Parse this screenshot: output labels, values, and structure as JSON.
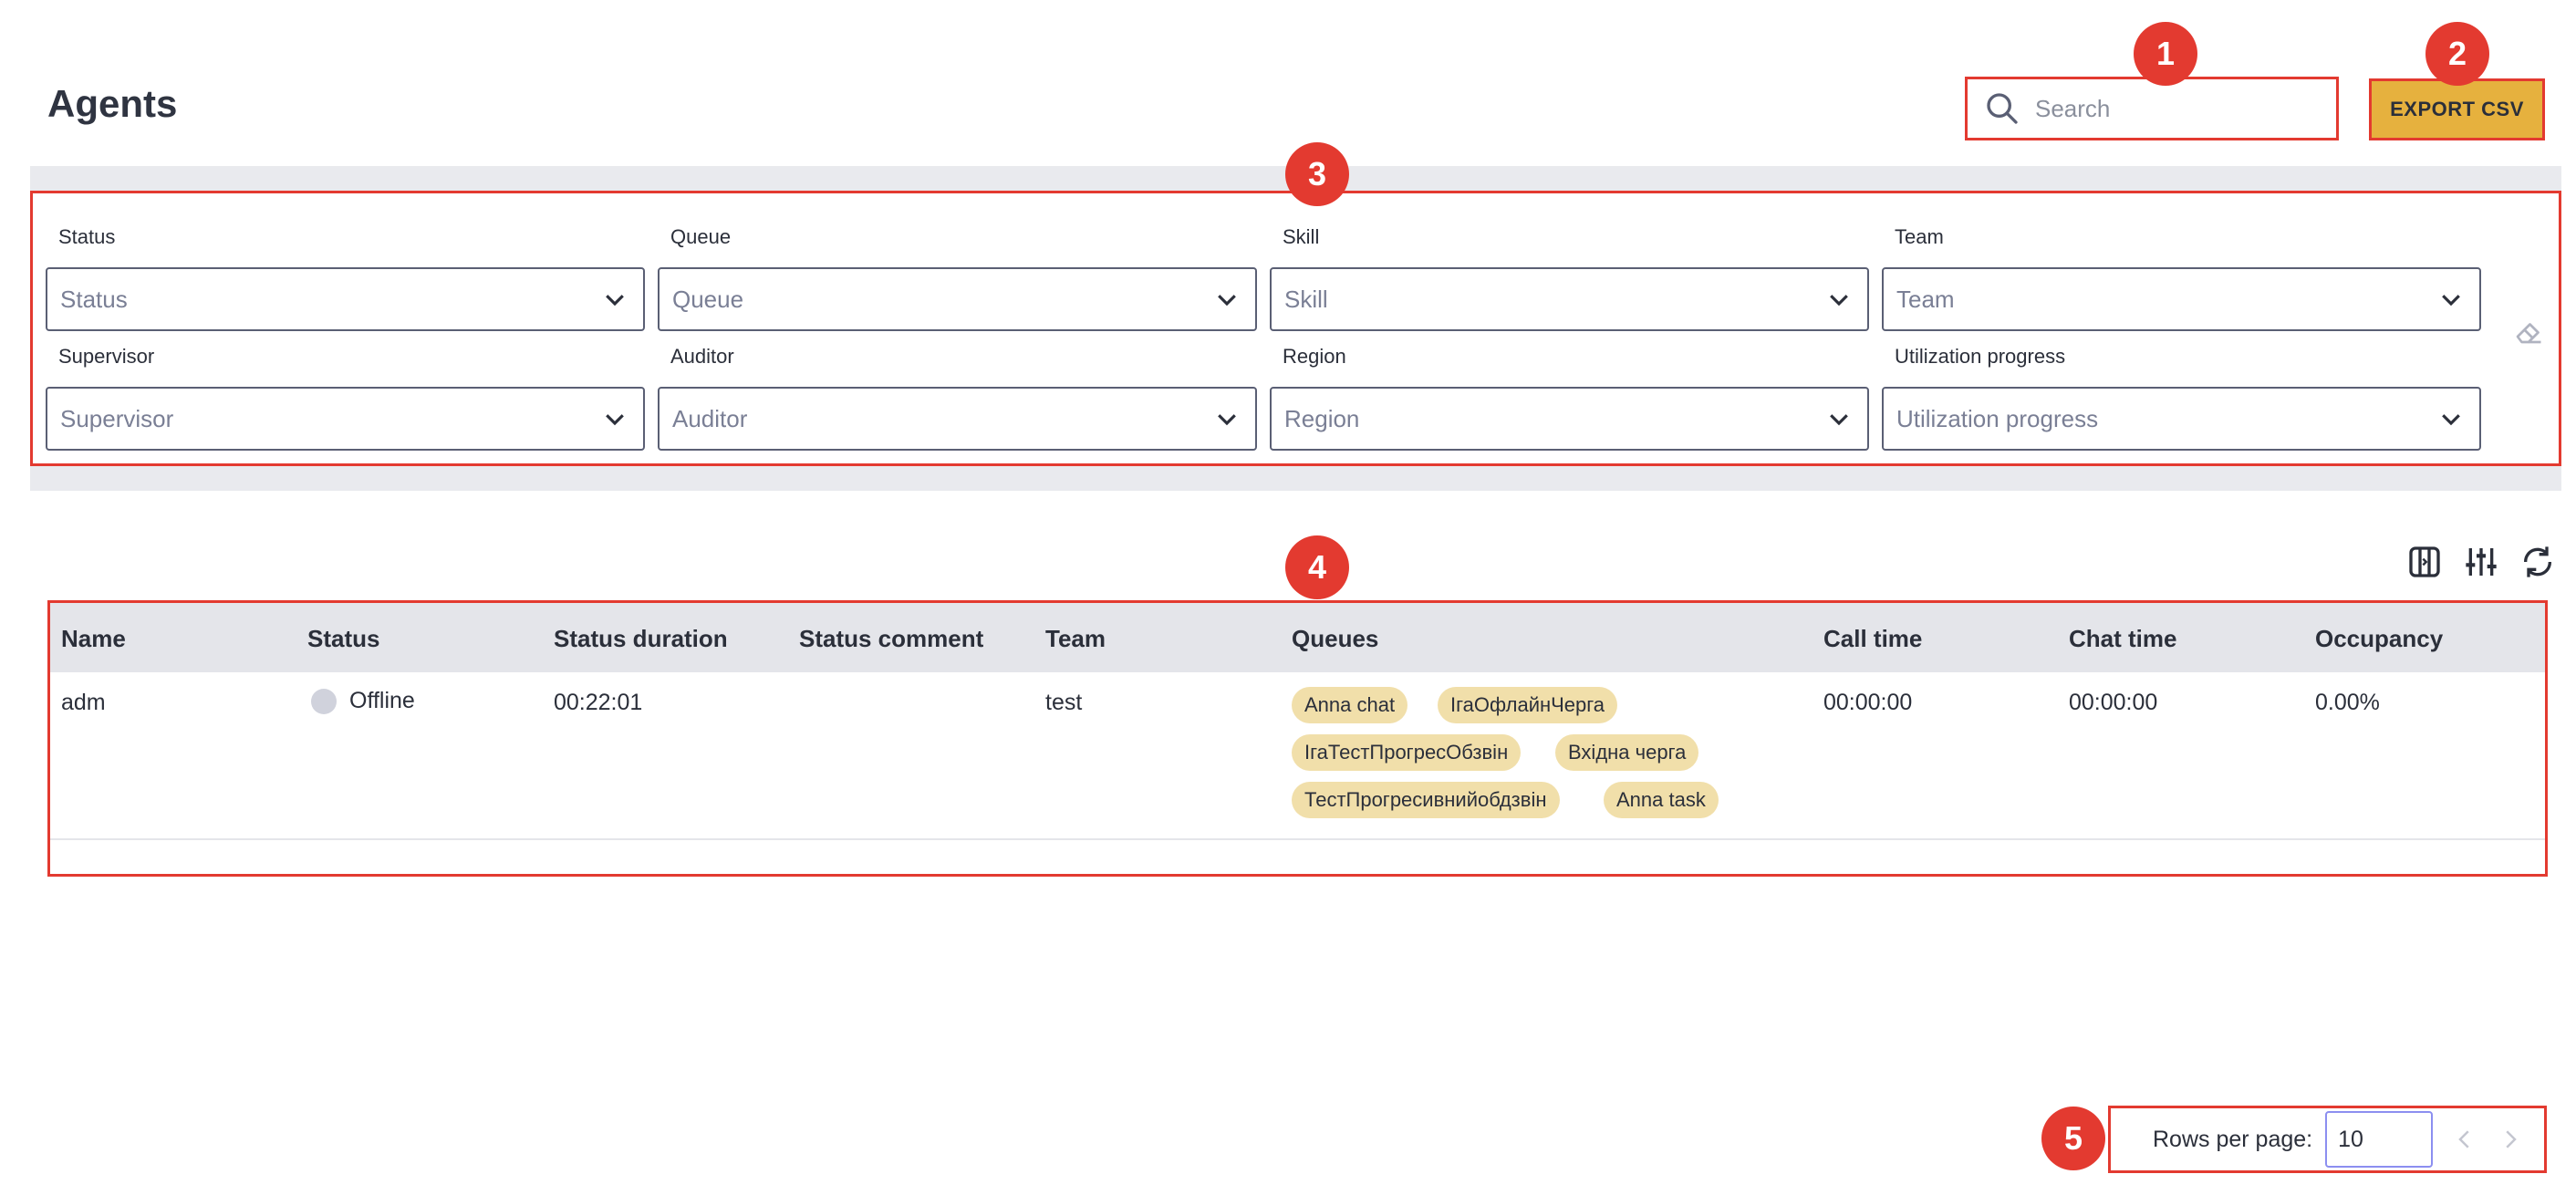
{
  "page": {
    "title": "Agents"
  },
  "search": {
    "placeholder": "Search"
  },
  "export": {
    "label": "EXPORT CSV"
  },
  "filters": [
    {
      "label": "Status",
      "placeholder": "Status"
    },
    {
      "label": "Queue",
      "placeholder": "Queue"
    },
    {
      "label": "Skill",
      "placeholder": "Skill"
    },
    {
      "label": "Team",
      "placeholder": "Team"
    },
    {
      "label": "Supervisor",
      "placeholder": "Supervisor"
    },
    {
      "label": "Auditor",
      "placeholder": "Auditor"
    },
    {
      "label": "Region",
      "placeholder": "Region"
    },
    {
      "label": "Utilization progress",
      "placeholder": "Utilization progress"
    }
  ],
  "table": {
    "columns": [
      "Name",
      "Status",
      "Status duration",
      "Status comment",
      "Team",
      "Queues",
      "Call time",
      "Chat time",
      "Occupancy"
    ],
    "rows": [
      {
        "name": "adm",
        "status": "Offline",
        "status_duration": "00:22:01",
        "status_comment": "",
        "team": "test",
        "queues": [
          "Anna chat",
          "ІгаОфлайнЧерга",
          "ІгаТестПрогресОбзвін",
          "Вхідна черга",
          "ТестПрогресивнийобдзвін",
          "Anna task"
        ],
        "call_time": "00:00:00",
        "chat_time": "00:00:00",
        "occupancy": "0.00%"
      }
    ]
  },
  "pagination": {
    "rows_label": "Rows per page:",
    "rows_value": "10"
  },
  "markers": [
    "1",
    "2",
    "3",
    "4",
    "5"
  ],
  "colors": {
    "accent": "#e6b13e",
    "highlight": "#e33a30",
    "chip": "#f1dfaa",
    "header_bg": "#e4e5ea"
  },
  "icons": [
    "search-icon",
    "chevron-down-icon",
    "eraser-icon",
    "expand-columns-icon",
    "column-settings-icon",
    "refresh-icon",
    "chevron-left-icon",
    "chevron-right-icon"
  ]
}
